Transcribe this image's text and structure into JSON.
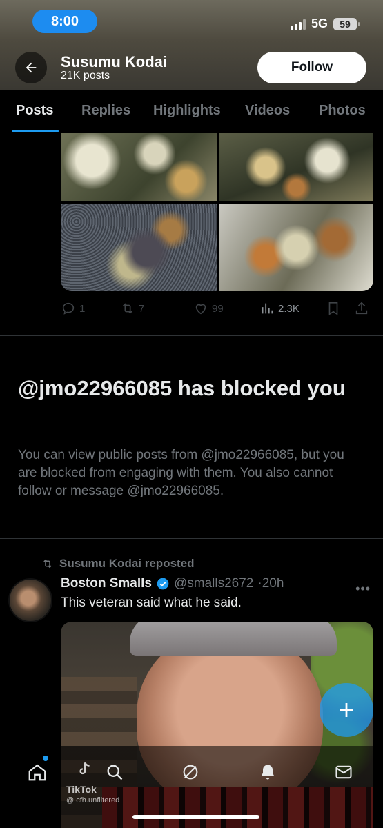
{
  "status_bar": {
    "time": "8:00",
    "network": "5G",
    "battery": "59"
  },
  "header": {
    "name": "Susumu Kodai",
    "posts": "21K posts",
    "follow_label": "Follow"
  },
  "tabs": [
    {
      "label": "Posts",
      "active": true
    },
    {
      "label": "Replies"
    },
    {
      "label": "Highlights"
    },
    {
      "label": "Videos"
    },
    {
      "label": "Photos"
    }
  ],
  "post_actions": {
    "replies": "1",
    "reposts": "7",
    "likes": "99",
    "views": "2.3K"
  },
  "blocked": {
    "title": "@jmo22966085 has blocked you",
    "body": "You can view public posts from @jmo22966085, but you are blocked from engaging with them. You also cannot follow or message @jmo22966085."
  },
  "repost": {
    "label": "Susumu Kodai reposted",
    "author_name": "Boston Smalls",
    "author_handle": "@smalls2672",
    "time": "·20h",
    "text": "This veteran said what he said."
  },
  "watermark": {
    "app": "TikTok",
    "user": "@ cfh.unfiltered"
  },
  "colors": {
    "accent": "#1d9bf0",
    "muted": "#71767b",
    "text": "#e7e9ea",
    "bg": "#000000"
  }
}
